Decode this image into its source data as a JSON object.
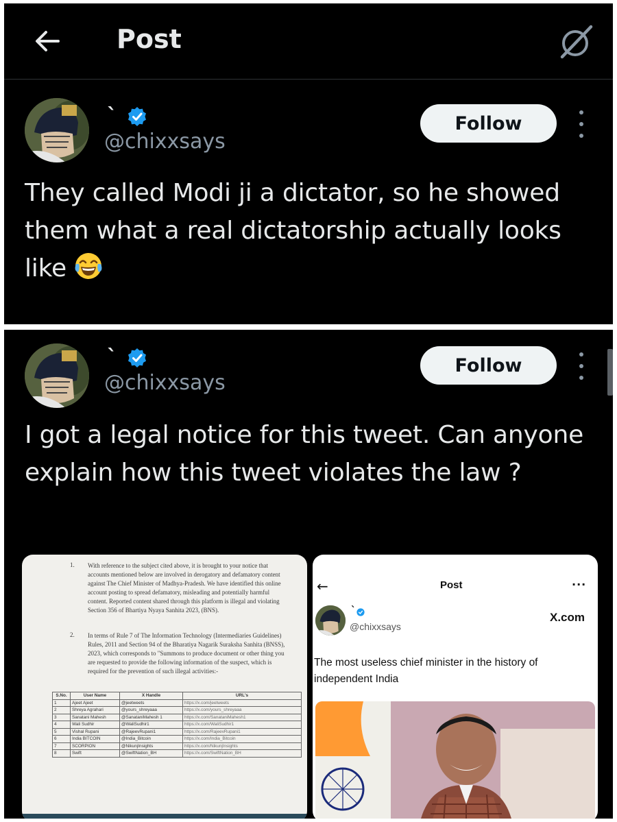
{
  "header": {
    "title": "Post",
    "back_icon": "arrow-left-icon",
    "grok_icon": "grok-icon"
  },
  "tweet1": {
    "display_name": "`",
    "handle": "@chixxsays",
    "follow_label": "Follow",
    "text": "They called Modi ji a dictator, so he showed them what a real dictatorship actually looks like",
    "emoji": "face-with-tears-of-joy"
  },
  "tweet2": {
    "display_name": "`",
    "handle": "@chixxsays",
    "follow_label": "Follow",
    "text": "I got a legal notice for this tweet. Can anyone explain how this tweet violates the law ?"
  },
  "document": {
    "item1_num": "1.",
    "item1_text": "With reference to the subject cited above, it is brought to your notice that accounts mentioned below are involved in derogatory and defamatory content against The Chief Minister of Madhya-Pradesh. We have identified this online account posting to spread defamatory, misleading and potentially harmful content. Reported content shared through this platform is illegal and violating Section 356 of Bhartiya Nyaya Sanhita 2023, (BNS).",
    "item2_num": "2.",
    "item2_text": "In terms of Rule 7 of The Information Technology (Intermediaries Guidelines) Rules, 2011 and Section 94 of the Bharatiya Nagarik Suraksha Sanhita (BNSS), 2023, which corresponds to \"Summons to produce document or other thing you are requested to provide the following information of the suspect, which is required for the prevention of such illegal activities:-",
    "table_headers": [
      "S.No.",
      "User Name",
      "X Handle",
      "URL's"
    ],
    "table_rows": [
      [
        "1",
        "Ajeet Ajeet",
        "@jeetweets",
        "https://x.com/jeetweets"
      ],
      [
        "2",
        "Shreya Agrahari",
        "@yours_shreyaaa",
        "https://x.com/yours_shreyaaa"
      ],
      [
        "3",
        "Sanatani Mahesh",
        "@SanataniMahesh 1",
        "https://x.com/SanataniMahesh1"
      ],
      [
        "4",
        "Wali Sudhir",
        "@WaliSudhir1",
        "https://x.com/WaliSudhir1"
      ],
      [
        "5",
        "Vishal Rupani",
        "@RajeevRupani1",
        "https://x.com/RajeevRupani1"
      ],
      [
        "6",
        "India BITCOIN",
        "@India_Bitcoin",
        "https://x.com/India_Bitcoin"
      ],
      [
        "7",
        "SCORPION",
        "@NikunjInsights",
        "https://x.com/NikunjInsights"
      ],
      [
        "8",
        "Swift",
        "@SwiftNation_BH",
        "https://x.com/SwiftNation_BH"
      ]
    ]
  },
  "screenshot": {
    "title": "Post",
    "more": "...",
    "display_name": "`",
    "handle": "@chixxsays",
    "watermark": "X.com",
    "text": "The most useless chief minister in the history of independent India"
  },
  "colors": {
    "background": "#000000",
    "text": "#e7e9ea",
    "secondary_text": "#8b98a5",
    "verified": "#1d9bf0",
    "follow_bg": "#eff3f4",
    "separator": "#ffffff"
  }
}
